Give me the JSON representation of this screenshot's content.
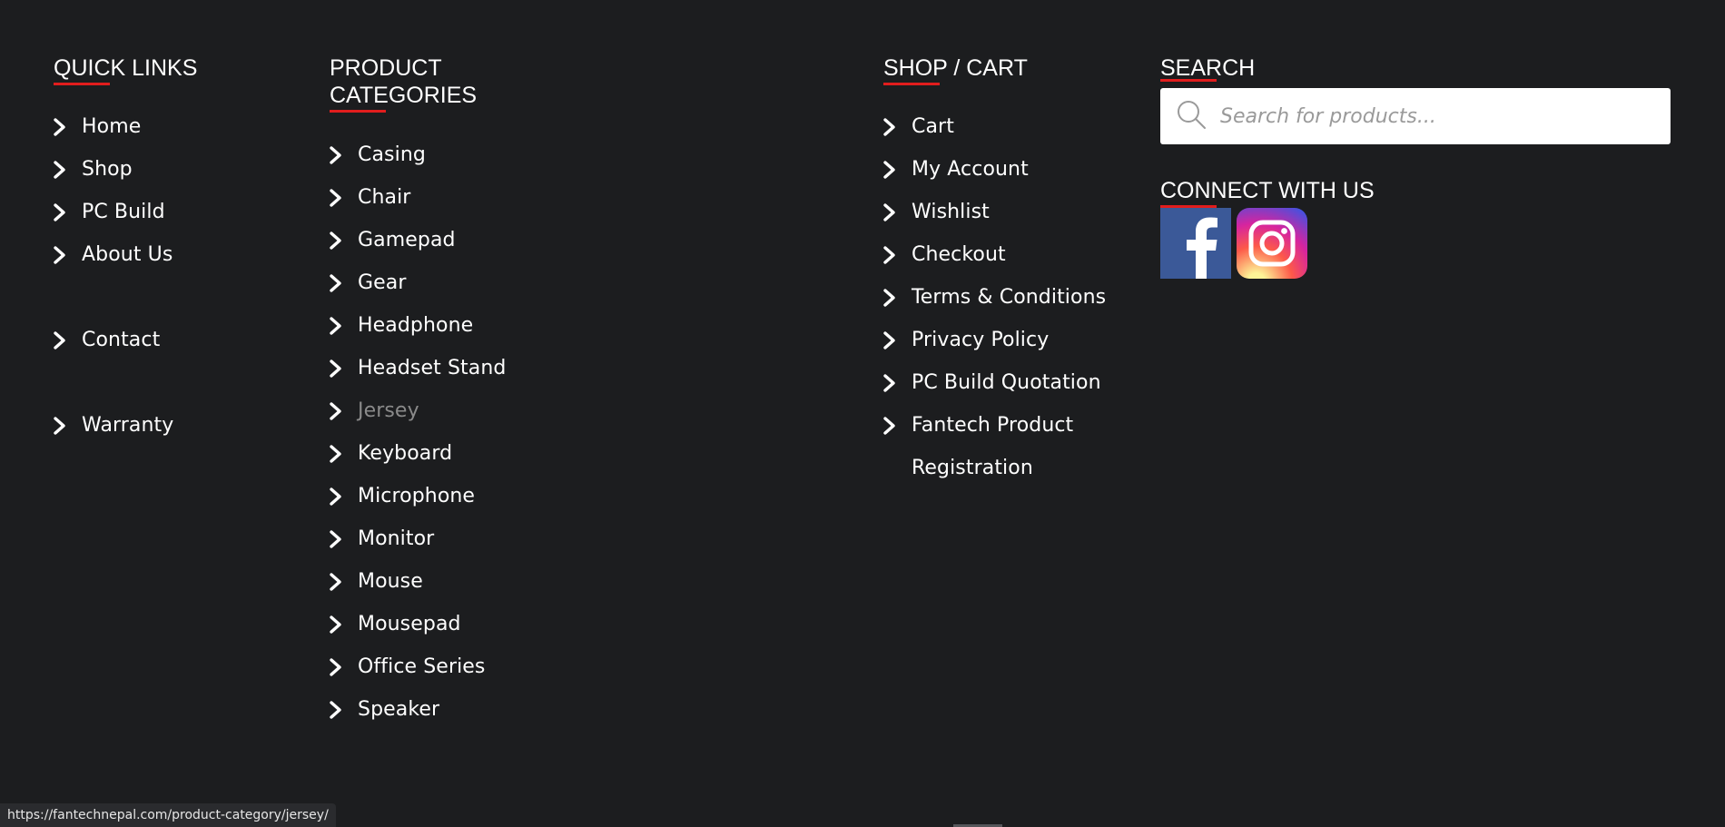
{
  "quick_links": {
    "heading": "QUICK LINKS",
    "items": [
      {
        "label": "Home"
      },
      {
        "label": "Shop"
      },
      {
        "label": "PC Build"
      },
      {
        "label": "About Us"
      },
      {
        "label": "Contact"
      },
      {
        "label": "Warranty"
      }
    ]
  },
  "product_categories": {
    "heading_line1": "PRODUCT",
    "heading_line2": "CATEGORIES",
    "items": [
      {
        "label": "Casing"
      },
      {
        "label": "Chair"
      },
      {
        "label": "Gamepad"
      },
      {
        "label": "Gear"
      },
      {
        "label": "Headphone"
      },
      {
        "label": "Headset Stand"
      },
      {
        "label": "Jersey",
        "state": "hovered"
      },
      {
        "label": "Keyboard"
      },
      {
        "label": "Microphone"
      },
      {
        "label": "Monitor"
      },
      {
        "label": "Mouse"
      },
      {
        "label": "Mousepad"
      },
      {
        "label": "Office Series"
      },
      {
        "label": "Speaker"
      }
    ]
  },
  "shop_cart": {
    "heading": "SHOP / CART",
    "items": [
      {
        "label": "Cart"
      },
      {
        "label": "My Account"
      },
      {
        "label": "Wishlist"
      },
      {
        "label": "Checkout"
      },
      {
        "label": "Terms & Conditions"
      },
      {
        "label": "Privacy Policy"
      },
      {
        "label": "PC Build Quotation"
      },
      {
        "label": "Fantech Product Registration"
      }
    ]
  },
  "search": {
    "heading": "SEARCH",
    "placeholder": "Search for products..."
  },
  "connect": {
    "heading": "CONNECT WITH US",
    "socials": [
      {
        "name": "facebook-icon",
        "color": "#3b5998"
      },
      {
        "name": "instagram-icon"
      }
    ]
  },
  "status_bar": {
    "url": "https://fantechnepal.com/product-category/jersey/"
  },
  "colors": {
    "background": "#1c1d1f",
    "accent_underline": "#e11d1d",
    "link": "#ffffff",
    "link_hover": "#8a8a8a"
  }
}
